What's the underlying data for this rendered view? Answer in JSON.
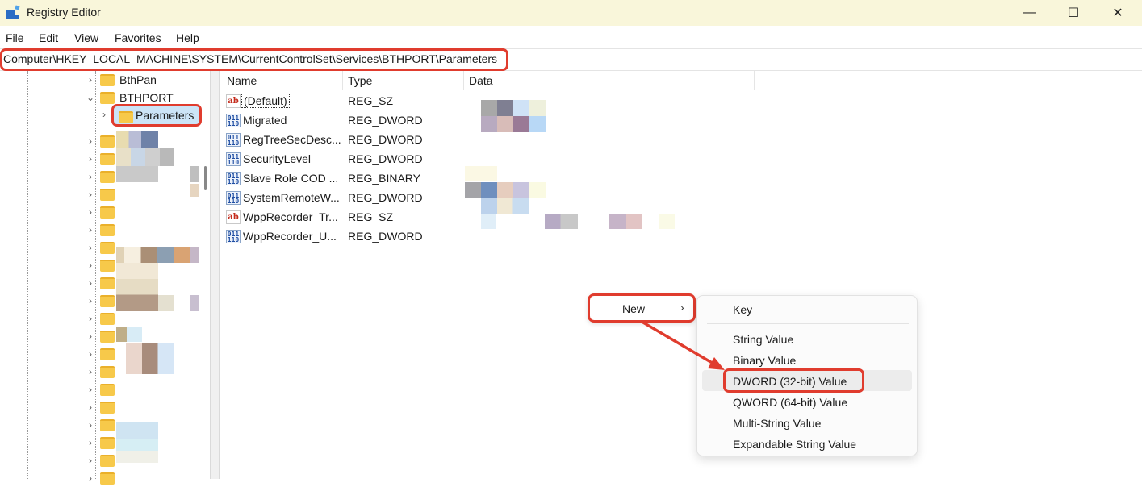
{
  "window": {
    "title": "Registry Editor",
    "minimize": "—",
    "maximize": "☐",
    "close": "✕"
  },
  "menu": [
    "File",
    "Edit",
    "View",
    "Favorites",
    "Help"
  ],
  "address": "Computer\\HKEY_LOCAL_MACHINE\\SYSTEM\\CurrentControlSet\\Services\\BTHPORT\\Parameters",
  "tree": {
    "bthpan": "BthPan",
    "bthport": "BTHPORT",
    "parameters": "Parameters"
  },
  "columns": {
    "name": "Name",
    "type": "Type",
    "data": "Data"
  },
  "values": [
    {
      "name": "(Default)",
      "type": "REG_SZ",
      "icon": "string-value-icon"
    },
    {
      "name": "Migrated",
      "type": "REG_DWORD",
      "icon": "binary-value-icon"
    },
    {
      "name": "RegTreeSecDesc...",
      "type": "REG_DWORD",
      "icon": "binary-value-icon"
    },
    {
      "name": "SecurityLevel",
      "type": "REG_DWORD",
      "icon": "binary-value-icon"
    },
    {
      "name": "Slave Role COD ...",
      "type": "REG_BINARY",
      "icon": "binary-value-icon"
    },
    {
      "name": "SystemRemoteW...",
      "type": "REG_DWORD",
      "icon": "binary-value-icon"
    },
    {
      "name": "WppRecorder_Tr...",
      "type": "REG_SZ",
      "icon": "string-value-icon"
    },
    {
      "name": "WppRecorder_U...",
      "type": "REG_DWORD",
      "icon": "binary-value-icon"
    }
  ],
  "context_menu": {
    "new_label": "New",
    "new_arrow": "›",
    "submenu": {
      "key": "Key",
      "string_value": "String Value",
      "binary_value": "Binary Value",
      "dword_value": "DWORD (32-bit) Value",
      "qword_value": "QWORD (64-bit) Value",
      "multi_string_value": "Multi-String Value",
      "expandable_string_value": "Expandable String Value"
    }
  },
  "icon_glyphs": {
    "sz": "ab",
    "dw": "011 110"
  },
  "colors": {
    "highlight": "#e03c2e",
    "folder": "#f7c94a",
    "titlebar": "#f9f6da",
    "selection": "#cce4f7"
  }
}
